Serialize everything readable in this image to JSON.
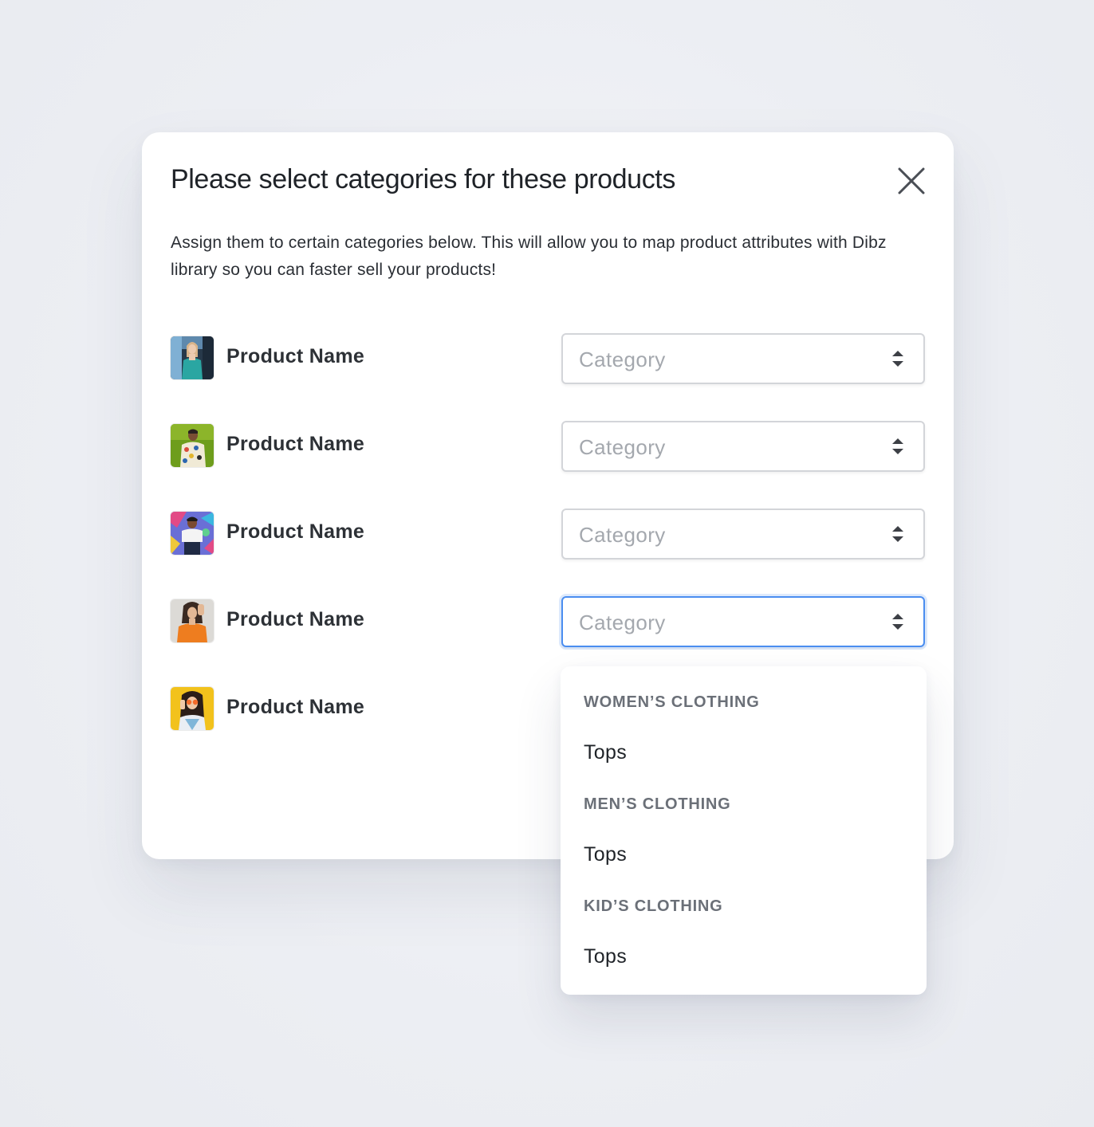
{
  "modal": {
    "title": "Please select categories for these products",
    "description": "Assign them to certain categories below. This will allow you to map product attributes with Dibz library so you can faster sell your products!",
    "close_icon": "close-icon"
  },
  "products": [
    {
      "name": "Product Name",
      "category_placeholder": "Category",
      "thumbnail": "woman-teal-top-photo"
    },
    {
      "name": "Product Name",
      "category_placeholder": "Category",
      "thumbnail": "man-patterned-shirt-photo"
    },
    {
      "name": "Product Name",
      "category_placeholder": "Category",
      "thumbnail": "man-graffiti-wall-photo"
    },
    {
      "name": "Product Name",
      "category_placeholder": "Category",
      "thumbnail": "woman-orange-sweater-photo"
    },
    {
      "name": "Product Name",
      "category_placeholder": "",
      "thumbnail": "woman-yellow-background-photo"
    }
  ],
  "dropdown": {
    "groups": [
      {
        "label": "WOMEN’S CLOTHING",
        "options": [
          "Tops"
        ]
      },
      {
        "label": "MEN’S CLOTHING",
        "options": [
          "Tops"
        ]
      },
      {
        "label": "KID’S CLOTHING",
        "options": [
          "Tops"
        ]
      }
    ]
  },
  "colors": {
    "focus_ring": "#4a8df0",
    "text_primary": "#1f2328",
    "placeholder": "#a4a8ae",
    "group_label": "#6b7078"
  }
}
